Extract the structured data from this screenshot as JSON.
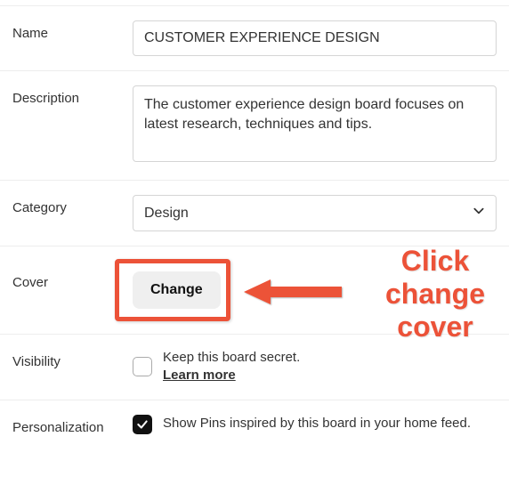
{
  "name": {
    "label": "Name",
    "value": "CUSTOMER EXPERIENCE DESIGN"
  },
  "description": {
    "label": "Description",
    "value": "The customer experience design board focuses on latest research, techniques and tips."
  },
  "category": {
    "label": "Category",
    "selected": "Design"
  },
  "cover": {
    "label": "Cover",
    "button": "Change"
  },
  "visibility": {
    "label": "Visibility",
    "text": "Keep this board secret.",
    "learn_more": "Learn more",
    "checked": false
  },
  "personalization": {
    "label": "Personalization",
    "text": "Show Pins inspired by this board in your home feed.",
    "checked": true
  },
  "annotation": {
    "text": "Click change cover"
  }
}
